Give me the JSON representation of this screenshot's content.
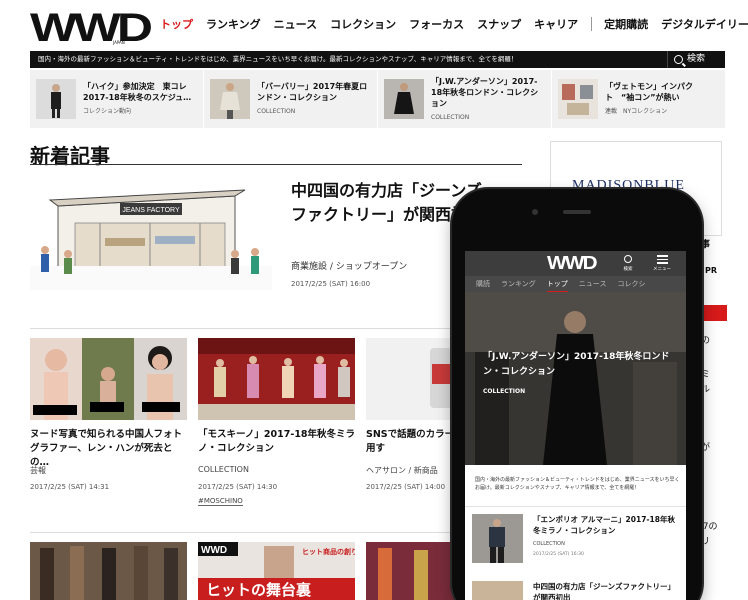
{
  "header": {
    "logo": "WWD",
    "logo_sub": "JAPAN",
    "nav": [
      "トップ",
      "ランキング",
      "ニュース",
      "コレクション",
      "フォーカス",
      "スナップ",
      "キャリア"
    ],
    "nav_extra": [
      "定期購読",
      "デジタルデイリー"
    ],
    "tagline": "国内・海外の最新ファッション＆ビューティ・トレンドをはじめ、業界ニュースをいち早くお届け。最新コレクションやスナップ、キャリア情報まで、全てを網羅！",
    "search_label": "検索"
  },
  "featured": [
    {
      "title": "「ハイク」参加決定　東コレ2017-18年秋冬のスケジュ…",
      "category": "コレクション動向"
    },
    {
      "title": "「バーバリー」2017年春夏ロンドン・コレクション",
      "category": "COLLECTION"
    },
    {
      "title": "「J.W.アンダーソン」2017-18年秋冬ロンドン・コレクション",
      "category": "COLLECTION"
    },
    {
      "title": "「ヴェトモン」インパクト　“袖コン”が熱い",
      "category": "連載　NYコレクション"
    }
  ],
  "main": {
    "section_title": "新着記事",
    "hero": {
      "title": "中四国の有力店「ジーンズファクトリー」が関西初出",
      "category": "商業施設 / ショップオープン",
      "date": "2017/2/25 (SAT) 16:00",
      "sign_text": "JEANS FACTORY"
    },
    "cards": [
      {
        "title": "ヌード写真で知られる中国人フォトグラファー、レン・ハンが死去との…",
        "category": "芸報",
        "date": "2017/2/25 (SAT) 14:31"
      },
      {
        "title": "「モスキーノ」2017-18年秋冬ミラノ・コレクション",
        "category": "COLLECTION",
        "date": "2017/2/25 (SAT) 14:30",
        "tag": "#MOSCHINO"
      },
      {
        "title": "SNSで話題のカラー人気サロンも愛用す",
        "category": "ヘアサロン / 新商品",
        "date": "2017/2/25 (SAT) 14:00"
      }
    ],
    "row2_banner": {
      "logo": "WWD",
      "headline": "ヒットの舞台裏",
      "subhead": "ヒット商品の創り方、仕掛け方"
    }
  },
  "sidebar": {
    "brand": "MADISONBLUE",
    "fragments": [
      "事",
      "PR",
      "の",
      "ミ",
      "ル",
      "が",
      "37の",
      "リ"
    ]
  },
  "phone": {
    "logo": "WWD",
    "search_label": "検索",
    "menu_label": "メニュー",
    "tabs": [
      "購読",
      "ランキング",
      "トップ",
      "ニュース",
      "コレクシ"
    ],
    "hero_title": "「J.W.アンダーソン」2017-18年秋冬ロンドン・コレクション",
    "hero_category": "COLLECTION",
    "tagline": "国内・海外の最新ファッション＆ビューティ・トレンドをはじめ、業界ニュースをいち早くお届け。最新コレクションやスナップ、キャリア情報まで、全てを網羅！",
    "item": {
      "title": "「エンポリオ アルマーニ」2017-18年秋冬ミラノ・コレクション",
      "category": "COLLECTION",
      "date": "2017/2/25 (SAT) 16:30"
    },
    "item2_title": "中四国の有力店「ジーンズファクトリー」が関西初出"
  },
  "colors": {
    "accent": "#d71a1a",
    "bar": "#111111",
    "featured_bg": "#f1f1f1",
    "brand_blue": "#1e2f66"
  }
}
